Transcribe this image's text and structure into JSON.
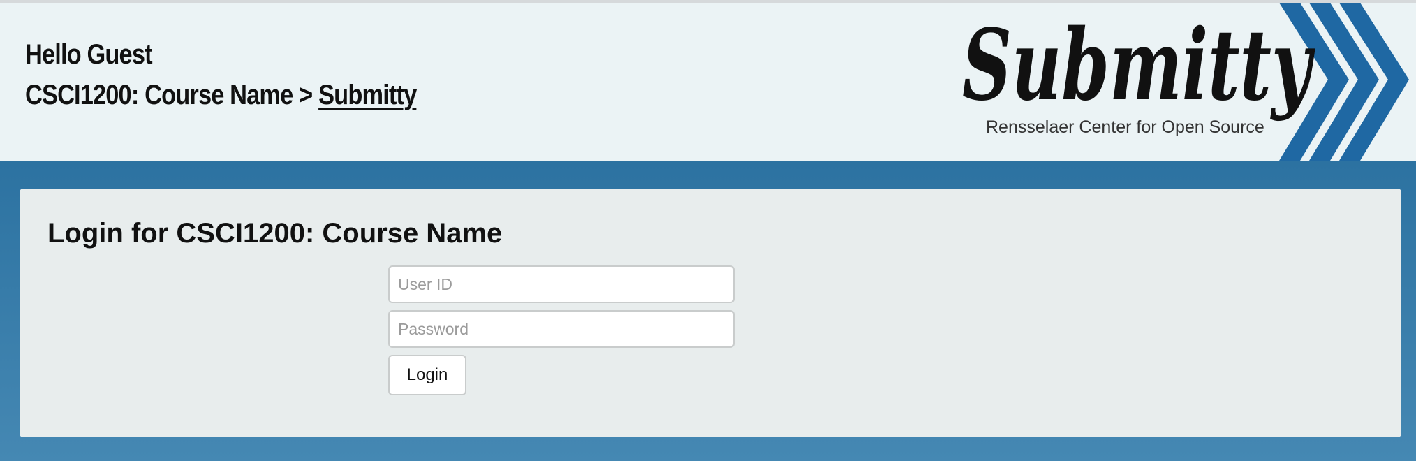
{
  "header": {
    "greeting": "Hello Guest",
    "breadcrumb": {
      "course": "CSCI1200: Course Name",
      "separator": ">",
      "current": "Submitty"
    }
  },
  "logo": {
    "wordmark": "Submitty",
    "tagline": "Rensselaer Center for Open Source",
    "chevron_color": "#1f68a3"
  },
  "login": {
    "title": "Login for CSCI1200: Course Name",
    "user_id_placeholder": "User ID",
    "password_placeholder": "Password",
    "button_label": "Login"
  },
  "colors": {
    "header_bg": "#ebf3f5",
    "accent_blue": "#2c72a1",
    "card_bg": "#e8eded"
  }
}
